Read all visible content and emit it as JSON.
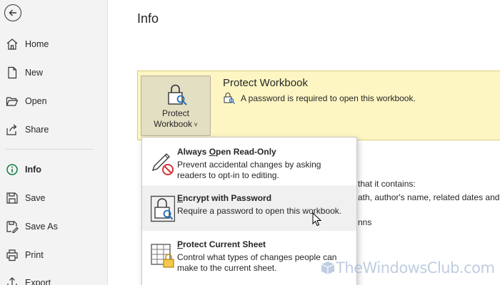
{
  "sidebar": {
    "items": [
      {
        "label": "Home",
        "icon": "home-icon"
      },
      {
        "label": "New",
        "icon": "new-document-icon"
      },
      {
        "label": "Open",
        "icon": "folder-open-icon"
      },
      {
        "label": "Share",
        "icon": "share-icon"
      },
      {
        "label": "Info",
        "icon": "info-icon"
      },
      {
        "label": "Save",
        "icon": "save-icon"
      },
      {
        "label": "Save As",
        "icon": "save-as-icon"
      },
      {
        "label": "Print",
        "icon": "print-icon"
      },
      {
        "label": "Export",
        "icon": "export-icon"
      }
    ]
  },
  "main": {
    "title": "Info",
    "protect": {
      "button_line1": "Protect",
      "button_line2": "Workbook",
      "title": "Protect Workbook",
      "description": "A password is required to open this workbook."
    },
    "background_text": {
      "line1": "that it contains:",
      "line2": "ath, author's name, related dates and a",
      "line3": "nns"
    },
    "menu": {
      "items": [
        {
          "title_pre": "Always ",
          "title_mnemonic": "O",
          "title_post": "pen Read-Only",
          "description": "Prevent accidental changes by asking readers to opt-in to editing.",
          "icon": "pencil-no-edit-icon"
        },
        {
          "title_pre": "",
          "title_mnemonic": "E",
          "title_post": "ncrypt with Password",
          "description": "Require a password to open this workbook.",
          "icon": "lock-key-icon"
        },
        {
          "title_pre": "",
          "title_mnemonic": "P",
          "title_post": "rotect Current Sheet",
          "description": "Control what types of changes people can make to the current sheet.",
          "icon": "sheet-lock-icon"
        }
      ]
    }
  },
  "watermark": {
    "text": "TheWindowsClub.com"
  }
}
